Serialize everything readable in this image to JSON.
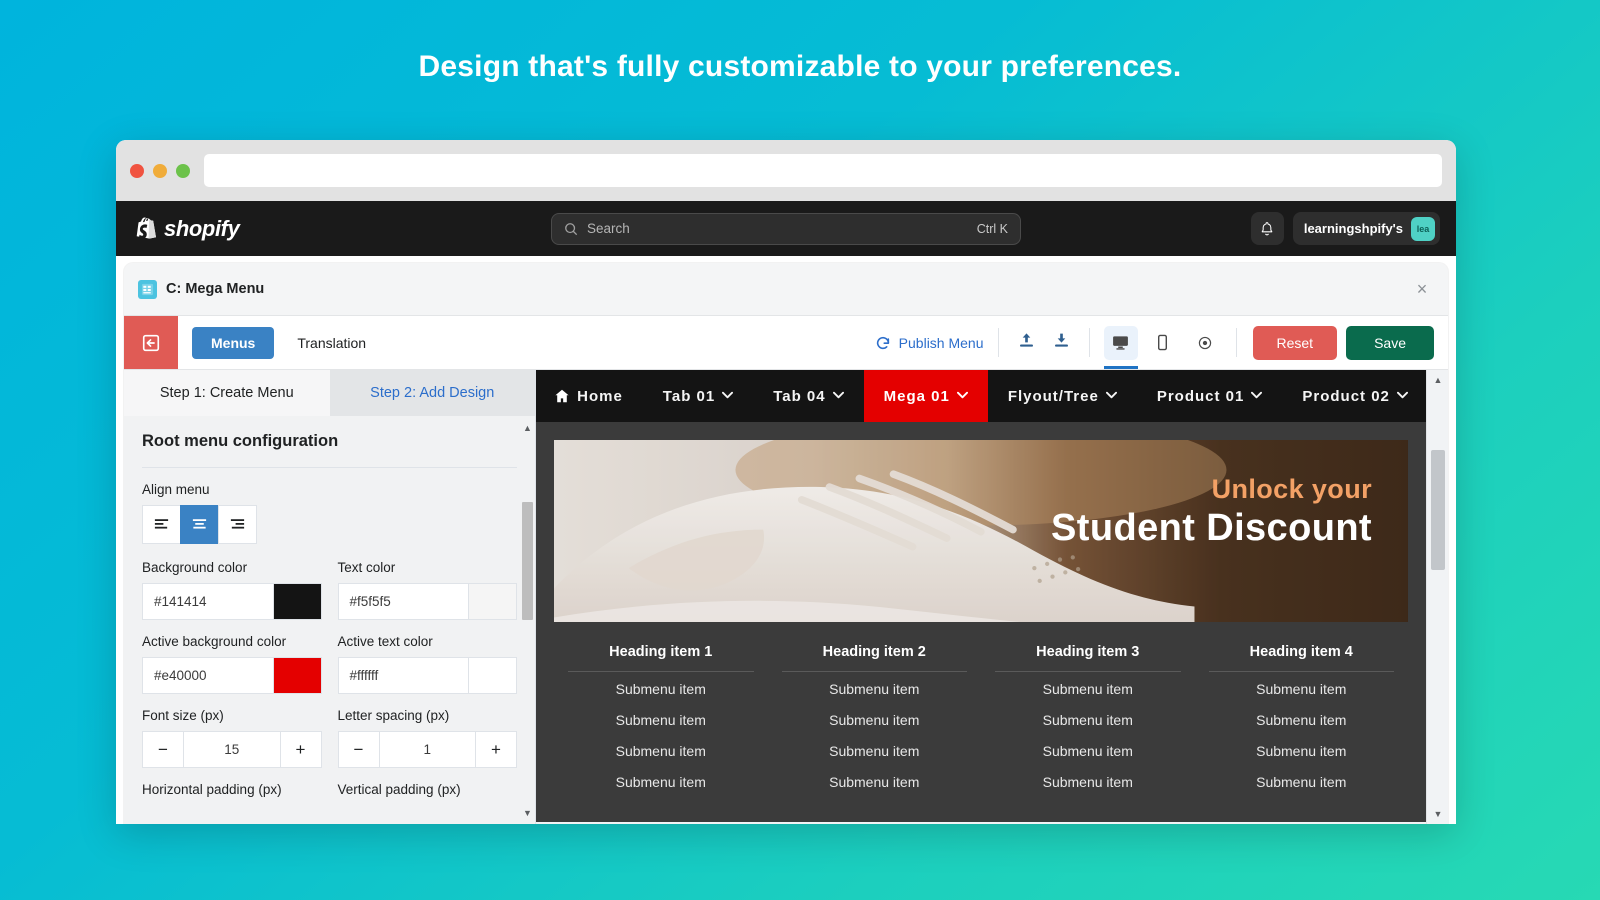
{
  "hero": {
    "title": "Design that's fully customizable to your preferences."
  },
  "browser": {
    "dots": [
      "close",
      "minimize",
      "maximize"
    ],
    "url_value": ""
  },
  "shopify_bar": {
    "brand": "shopify",
    "search": {
      "placeholder": "Search",
      "shortcut": "Ctrl K",
      "icon": "search-icon"
    },
    "bell_icon": "bell-icon",
    "store_name": "learningshpify's",
    "avatar_initials": "lea"
  },
  "app": {
    "title": "C: Mega Menu",
    "icon": "app-grid-icon",
    "close_label": "×"
  },
  "toolbar": {
    "back_icon": "back-arrow-icon",
    "tabs": [
      {
        "label": "Menus",
        "active": true
      },
      {
        "label": "Translation",
        "active": false
      }
    ],
    "publish_label": "Publish Menu",
    "publish_icon": "refresh-icon",
    "upload_icon": "upload-icon",
    "download_icon": "download-icon",
    "views": [
      {
        "name": "desktop-view",
        "icon": "desktop-icon",
        "active": true
      },
      {
        "name": "mobile-view",
        "icon": "mobile-icon",
        "active": false
      },
      {
        "name": "preview-view",
        "icon": "eye-icon",
        "active": false
      }
    ],
    "reset_label": "Reset",
    "save_label": "Save",
    "reset_color": "#e05b55",
    "save_color": "#0a6b4d"
  },
  "steps": [
    {
      "label": "Step 1: Create Menu",
      "active": false
    },
    {
      "label": "Step 2: Add Design",
      "active": true
    }
  ],
  "config": {
    "section_title": "Root menu configuration",
    "align_label": "Align menu",
    "align_options": [
      "align-left-icon",
      "align-center-icon",
      "align-right-icon"
    ],
    "align_selected": 1,
    "fields": {
      "background_color": {
        "label": "Background color",
        "value": "#141414",
        "swatch": "#141414"
      },
      "text_color": {
        "label": "Text color",
        "value": "#f5f5f5",
        "swatch": "#f5f5f5"
      },
      "active_background_color": {
        "label": "Active background color",
        "value": "#e40000",
        "swatch": "#e40000"
      },
      "active_text_color": {
        "label": "Active text color",
        "value": "#ffffff",
        "swatch": "#ffffff"
      },
      "font_size": {
        "label": "Font size (px)",
        "value": "15",
        "minus": "−",
        "plus": "+"
      },
      "letter_spacing": {
        "label": "Letter spacing (px)",
        "value": "1",
        "minus": "−",
        "plus": "+"
      },
      "horizontal_padding": {
        "label": "Horizontal padding (px)"
      },
      "vertical_padding": {
        "label": "Vertical padding (px)"
      }
    }
  },
  "preview": {
    "menu": [
      {
        "label": "Home",
        "icon": "home-icon",
        "caret": false,
        "active": false
      },
      {
        "label": "Tab 01",
        "icon": null,
        "caret": true,
        "active": false
      },
      {
        "label": "Tab 04",
        "icon": null,
        "caret": true,
        "active": false
      },
      {
        "label": "Mega 01",
        "icon": null,
        "caret": true,
        "active": true
      },
      {
        "label": "Flyout/Tree",
        "icon": null,
        "caret": true,
        "active": false
      },
      {
        "label": "Product 01",
        "icon": null,
        "caret": true,
        "active": false
      },
      {
        "label": "Product 02",
        "icon": null,
        "caret": true,
        "active": false
      }
    ],
    "caret_glyph": "⌄",
    "banner": {
      "line1": "Unlock your",
      "line2": "Student Discount",
      "line1_color": "#f3a166",
      "line2_color": "#ffffff",
      "alt": "white-sneaker-photo"
    },
    "columns": [
      {
        "heading": "Heading item 1",
        "items": [
          "Submenu item",
          "Submenu item",
          "Submenu item",
          "Submenu item"
        ]
      },
      {
        "heading": "Heading item 2",
        "items": [
          "Submenu item",
          "Submenu item",
          "Submenu item",
          "Submenu item"
        ]
      },
      {
        "heading": "Heading item 3",
        "items": [
          "Submenu item",
          "Submenu item",
          "Submenu item",
          "Submenu item"
        ]
      },
      {
        "heading": "Heading item 4",
        "items": [
          "Submenu item",
          "Submenu item",
          "Submenu item",
          "Submenu item"
        ]
      }
    ]
  }
}
